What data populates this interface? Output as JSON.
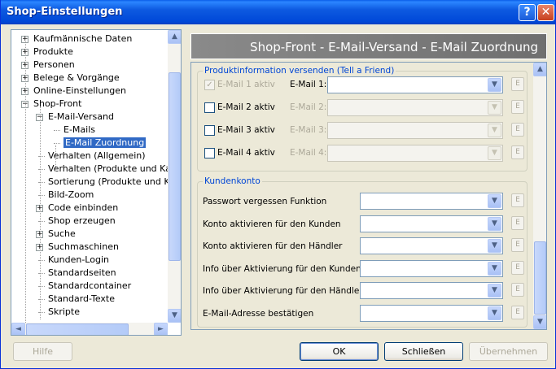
{
  "window": {
    "title": "Shop-Einstellungen",
    "help_btn": "?",
    "close_btn": "✕"
  },
  "tree": {
    "items": [
      {
        "label": "Kaufmännische Daten",
        "expander": "+"
      },
      {
        "label": "Produkte",
        "expander": "+"
      },
      {
        "label": "Personen",
        "expander": "+"
      },
      {
        "label": "Belege & Vorgänge",
        "expander": "+"
      },
      {
        "label": "Online-Einstellungen",
        "expander": "+"
      },
      {
        "label": "Shop-Front",
        "expander": "−"
      },
      {
        "label": "E-Mail-Versand",
        "expander": "−"
      },
      {
        "label": "E-Mails"
      },
      {
        "label": "E-Mail Zuordnung",
        "selected": true
      },
      {
        "label": "Verhalten (Allgemein)"
      },
      {
        "label": "Verhalten (Produkte und Kateg"
      },
      {
        "label": "Sortierung (Produkte und Kateg"
      },
      {
        "label": "Bild-Zoom"
      },
      {
        "label": "Code einbinden",
        "expander": "+"
      },
      {
        "label": "Shop erzeugen"
      },
      {
        "label": "Suche",
        "expander": "+"
      },
      {
        "label": "Suchmaschinen",
        "expander": "+"
      },
      {
        "label": "Kunden-Login"
      },
      {
        "label": "Standardseiten"
      },
      {
        "label": "Standardcontainer"
      },
      {
        "label": "Standard-Texte"
      },
      {
        "label": "Skripte"
      }
    ]
  },
  "header": {
    "title": "Shop-Front - E-Mail-Versand - E-Mail Zuordnung"
  },
  "product_group": {
    "legend": "Produktinformation versenden (Tell a Friend)",
    "rows": [
      {
        "checkbox_label": "E-Mail 1 aktiv",
        "field_label": "E-Mail 1:",
        "checked": true,
        "checkbox_disabled": true,
        "field_enabled": true,
        "value": ""
      },
      {
        "checkbox_label": "E-Mail 2 aktiv",
        "field_label": "E-Mail 2:",
        "checked": false,
        "checkbox_disabled": false,
        "field_enabled": false,
        "value": ""
      },
      {
        "checkbox_label": "E-Mail 3 aktiv",
        "field_label": "E-Mail 3:",
        "checked": false,
        "checkbox_disabled": false,
        "field_enabled": false,
        "value": ""
      },
      {
        "checkbox_label": "E-Mail 4 aktiv",
        "field_label": "E-Mail 4:",
        "checked": false,
        "checkbox_disabled": false,
        "field_enabled": false,
        "value": ""
      }
    ],
    "edit_label": "E"
  },
  "account_group": {
    "legend": "Kundenkonto",
    "rows": [
      {
        "label": "Passwort vergessen Funktion",
        "value": ""
      },
      {
        "label": "Konto aktivieren für den Kunden",
        "value": ""
      },
      {
        "label": "Konto aktivieren für den Händler",
        "value": ""
      },
      {
        "label": "Info über Aktivierung für den Kunden",
        "value": ""
      },
      {
        "label": "Info über Aktivierung für den Händler",
        "value": ""
      },
      {
        "label": "E-Mail-Adresse bestätigen",
        "value": ""
      }
    ],
    "edit_label": "E"
  },
  "footer": {
    "help": "Hilfe",
    "ok": "OK",
    "close": "Schließen",
    "apply": "Übernehmen"
  },
  "scroll": {
    "up": "▲",
    "down": "▼",
    "left": "◄",
    "right": "►",
    "dropdown": "▼"
  }
}
